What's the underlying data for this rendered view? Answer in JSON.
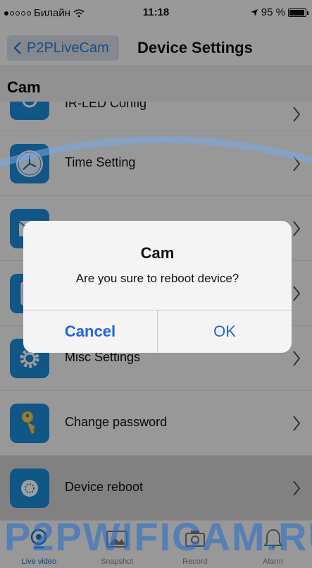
{
  "status_bar": {
    "carrier": "Билайн",
    "time": "11:18",
    "battery_text": "95 %",
    "battery_level": 0.95
  },
  "nav": {
    "back_label": "P2PLiveCam",
    "title": "Device Settings"
  },
  "section": {
    "title": "Cam"
  },
  "list_items": [
    {
      "label": "IR-LED Config",
      "icon": "ir-led-icon"
    },
    {
      "label": "Time Setting",
      "icon": "clock-icon"
    },
    {
      "label": "",
      "icon": "mail-icon"
    },
    {
      "label": "",
      "icon": "storage-icon"
    },
    {
      "label": "Misc Settings",
      "icon": "gear-icon"
    },
    {
      "label": "Change password",
      "icon": "key-icon"
    },
    {
      "label": "Device reboot",
      "icon": "reboot-icon"
    }
  ],
  "dialog": {
    "title": "Cam",
    "message": "Are you sure to reboot device?",
    "cancel_label": "Cancel",
    "ok_label": "OK"
  },
  "tabs": [
    {
      "label": "Live video",
      "icon": "live-video-icon"
    },
    {
      "label": "Snapshot",
      "icon": "snapshot-icon"
    },
    {
      "label": "Record",
      "icon": "record-icon"
    },
    {
      "label": "Alarm",
      "icon": "alarm-icon"
    }
  ],
  "watermark": "P2PWIFICAM.RU",
  "colors": {
    "accent": "#1f64d9",
    "icon_bg": "#1b8bd8"
  }
}
